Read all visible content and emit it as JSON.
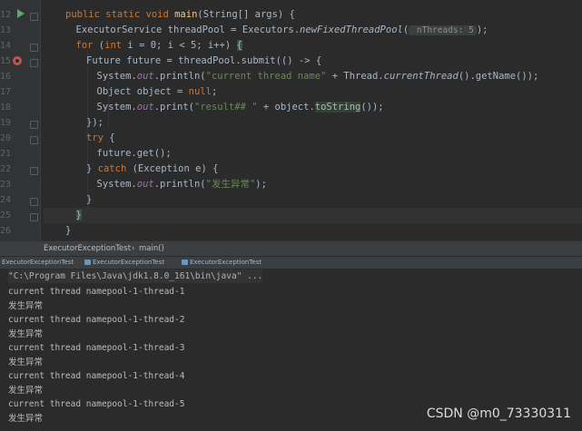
{
  "editor": {
    "line_numbers": [
      "12",
      "13",
      "14",
      "15",
      "16",
      "17",
      "18",
      "19",
      "20",
      "21",
      "22",
      "23",
      "24",
      "25",
      "26"
    ],
    "lines": [
      [
        {
          "t": "public static void ",
          "c": "kw"
        },
        {
          "t": "main",
          "c": "fn"
        },
        {
          "t": "(String[] args) {",
          "c": ""
        }
      ],
      [
        {
          "t": "ExecutorService threadPool = Executors.",
          "c": ""
        },
        {
          "t": "newFixedThreadPool",
          "c": "it"
        },
        {
          "t": "(",
          "c": ""
        },
        {
          "t": " nThreads: 5",
          "c": "hint"
        },
        {
          "t": ");",
          "c": ""
        }
      ],
      [
        {
          "t": "for ",
          "c": "kw"
        },
        {
          "t": "(",
          "c": ""
        },
        {
          "t": "int ",
          "c": "kw"
        },
        {
          "t": "i = 0; i < 5; i++) ",
          "c": ""
        },
        {
          "t": "{",
          "c": "brace"
        }
      ],
      [
        {
          "t": "Future future = threadPool.submit(() -> {",
          "c": ""
        }
      ],
      [
        {
          "t": "System.",
          "c": ""
        },
        {
          "t": "out",
          "c": "st"
        },
        {
          "t": ".println(",
          "c": ""
        },
        {
          "t": "\"current thread name\"",
          "c": "str"
        },
        {
          "t": " + Thread.",
          "c": ""
        },
        {
          "t": "currentThread",
          "c": "it"
        },
        {
          "t": "().getName());",
          "c": ""
        }
      ],
      [
        {
          "t": "Object object = ",
          "c": ""
        },
        {
          "t": "null",
          "c": "kw"
        },
        {
          "t": ";",
          "c": ""
        }
      ],
      [
        {
          "t": "System.",
          "c": ""
        },
        {
          "t": "out",
          "c": "st"
        },
        {
          "t": ".print(",
          "c": ""
        },
        {
          "t": "\"result## \"",
          "c": "str"
        },
        {
          "t": " + object.",
          "c": ""
        },
        {
          "t": "toString",
          "c": "hl"
        },
        {
          "t": "());",
          "c": ""
        }
      ],
      [
        {
          "t": "});",
          "c": ""
        }
      ],
      [
        {
          "t": "try ",
          "c": "kw"
        },
        {
          "t": "{",
          "c": ""
        }
      ],
      [
        {
          "t": "future.get();",
          "c": ""
        }
      ],
      [
        {
          "t": "} ",
          "c": ""
        },
        {
          "t": "catch ",
          "c": "kw"
        },
        {
          "t": "(Exception e) {",
          "c": ""
        }
      ],
      [
        {
          "t": "System.",
          "c": ""
        },
        {
          "t": "out",
          "c": "st"
        },
        {
          "t": ".println(",
          "c": ""
        },
        {
          "t": "\"发生异常\"",
          "c": "str"
        },
        {
          "t": ");",
          "c": ""
        }
      ],
      [
        {
          "t": "}",
          "c": ""
        }
      ],
      [
        {
          "t": "}",
          "c": "brace"
        }
      ],
      [
        {
          "t": "}",
          "c": ""
        }
      ]
    ],
    "indents": [
      2,
      3,
      3,
      4,
      5,
      5,
      5,
      4,
      4,
      5,
      4,
      5,
      4,
      3,
      2
    ],
    "current_line_index": 13
  },
  "breadcrumb": {
    "class": "ExecutorExceptionTest",
    "sep": "›",
    "method": "main()"
  },
  "run_tabs": [
    "ExecutorExceptionTest",
    "ExecutorExceptionTest",
    "ExecutorExceptionTest"
  ],
  "console": {
    "command": "\"C:\\Program Files\\Java\\jdk1.8.0_161\\bin\\java\" ...",
    "lines": [
      "current thread namepool-1-thread-1",
      "发生异常",
      "current thread namepool-1-thread-2",
      "发生异常",
      "current thread namepool-1-thread-3",
      "发生异常",
      "current thread namepool-1-thread-4",
      "发生异常",
      "current thread namepool-1-thread-5",
      "发生异常"
    ]
  },
  "watermark": "CSDN @m0_73330311",
  "colors": {
    "keyword": "#cc7832",
    "method": "#ffc66d",
    "string": "#6a8759",
    "static_field": "#9876aa",
    "run": "#59a869",
    "breakpoint": "#c75450"
  },
  "icons": {
    "run": "run-arrow-icon",
    "breakpoint": "breakpoint-icon",
    "fold": "fold-marker-icon",
    "tab": "run-config-icon"
  }
}
